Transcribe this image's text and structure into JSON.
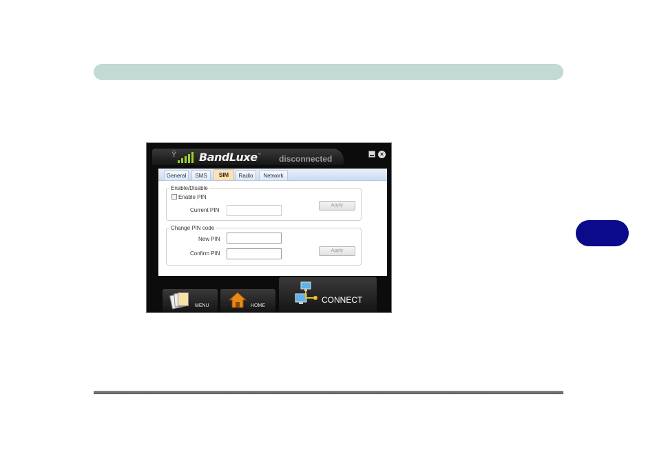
{
  "window": {
    "brand": "BandLuxe",
    "brand_tm": "™",
    "status": "disconnected",
    "close_glyph": "×",
    "signal_glyph": "Ÿ"
  },
  "tabs": [
    "General",
    "SMS",
    "SIM",
    "Radio",
    "Network"
  ],
  "active_tab": "SIM",
  "enable_group": {
    "title": "Enable/Disable",
    "checkbox_label": "Enable PIN",
    "checkbox_checked": false,
    "current_pin_label": "Current PIN",
    "current_pin_value": "",
    "apply_label": "Apply"
  },
  "change_group": {
    "title": "Change PIN code",
    "new_pin_label": "New PIN",
    "new_pin_value": "",
    "confirm_pin_label": "Confirm PIN",
    "confirm_pin_value": "",
    "apply_label": "Apply"
  },
  "footer": {
    "menu_label": "MENU",
    "home_label": "HOME",
    "connect_label": "CONNECT"
  },
  "colors": {
    "header_bar": "#c3d9d3",
    "chapter_tab": "#0a0a8a",
    "signal_green": "#9bd12a",
    "active_tab": "#ffe0b0"
  }
}
